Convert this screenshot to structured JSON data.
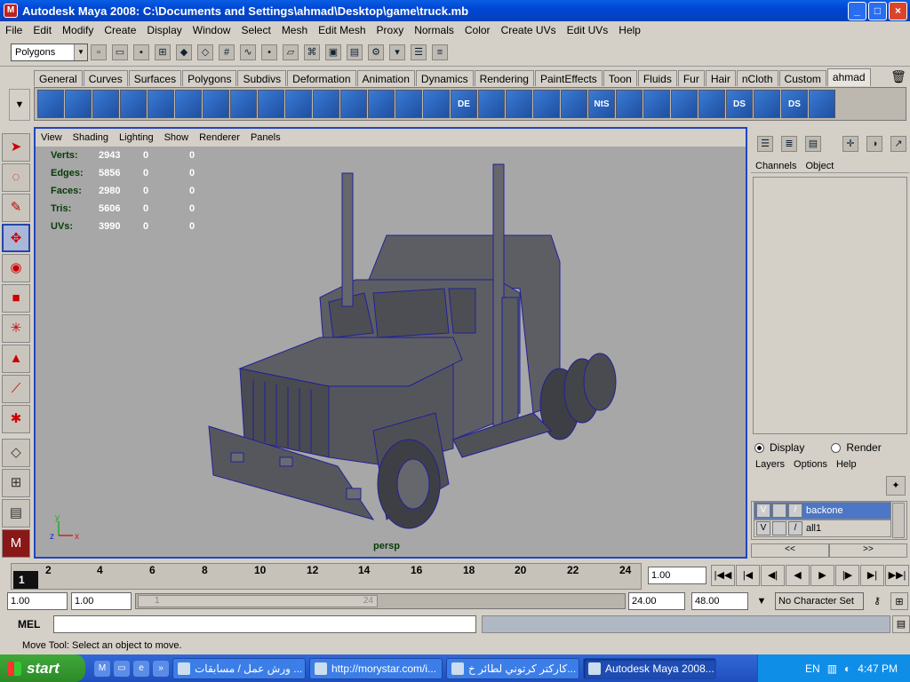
{
  "window": {
    "title": "Autodesk Maya 2008: C:\\Documents and Settings\\ahmad\\Desktop\\game\\truck.mb",
    "min": "_",
    "max": "□",
    "close": "×"
  },
  "menubar": [
    "File",
    "Edit",
    "Modify",
    "Create",
    "Display",
    "Window",
    "Select",
    "Mesh",
    "Edit Mesh",
    "Proxy",
    "Normals",
    "Color",
    "Create UVs",
    "Edit UVs",
    "Help"
  ],
  "status": {
    "mode": "Polygons"
  },
  "shelf": {
    "tabs": [
      "General",
      "Curves",
      "Surfaces",
      "Polygons",
      "Subdivs",
      "Deformation",
      "Animation",
      "Dynamics",
      "Rendering",
      "PaintEffects",
      "Toon",
      "Fluids",
      "Fur",
      "Hair",
      "nCloth",
      "Custom",
      "ahmad"
    ],
    "active_tab": "ahmad",
    "icon_labels": [
      "DE",
      "NtS",
      "DS",
      "DS"
    ]
  },
  "viewport": {
    "menu": [
      "View",
      "Shading",
      "Lighting",
      "Show",
      "Renderer",
      "Panels"
    ],
    "hud": [
      {
        "label": "Verts:",
        "a": "2943",
        "b": "0",
        "c": "0"
      },
      {
        "label": "Edges:",
        "a": "5856",
        "b": "0",
        "c": "0"
      },
      {
        "label": "Faces:",
        "a": "2980",
        "b": "0",
        "c": "0"
      },
      {
        "label": "Tris:",
        "a": "5606",
        "b": "0",
        "c": "0"
      },
      {
        "label": "UVs:",
        "a": "3990",
        "b": "0",
        "c": "0"
      }
    ],
    "camera": "persp",
    "axis": {
      "y": "y",
      "z": "z",
      "x": "x"
    },
    "colors": {
      "bg": "#a7a7a7",
      "border": "#2245c0",
      "mesh": "#5d5e63",
      "wire": "#20209a"
    }
  },
  "channel_box": {
    "menu": [
      "Channels",
      "Object"
    ]
  },
  "layers": {
    "display_label": "Display",
    "render_label": "Render",
    "menu": [
      "Layers",
      "Options",
      "Help"
    ],
    "items": [
      {
        "vis": "V",
        "name": "backone",
        "selected": true
      },
      {
        "vis": "V",
        "name": "all1",
        "selected": false
      }
    ],
    "prev": "<<",
    "next": ">>"
  },
  "timeline": {
    "ticks": [
      "2",
      "4",
      "6",
      "8",
      "10",
      "12",
      "14",
      "16",
      "18",
      "20",
      "22",
      "24"
    ],
    "current": "1",
    "current_frame_field": "1.00"
  },
  "range": {
    "start": "1.00",
    "start2": "1.00",
    "slider_start": "1",
    "slider_end": "24",
    "end": "24.00",
    "end2": "48.00",
    "character_set": "No Character Set"
  },
  "mel": {
    "label": "MEL"
  },
  "help_line": "Move Tool: Select an object to move.",
  "taskbar": {
    "start": "start",
    "tasks": [
      {
        "label": "ورش عمل / مسابقات ...",
        "active": false
      },
      {
        "label": "http://morystar.com/i...",
        "active": false
      },
      {
        "label": "كاركتر كرتوني لطائر خ...",
        "active": false
      },
      {
        "label": "Autodesk Maya 2008...",
        "active": true
      }
    ],
    "lang": "EN",
    "clock": "4:47 PM"
  }
}
